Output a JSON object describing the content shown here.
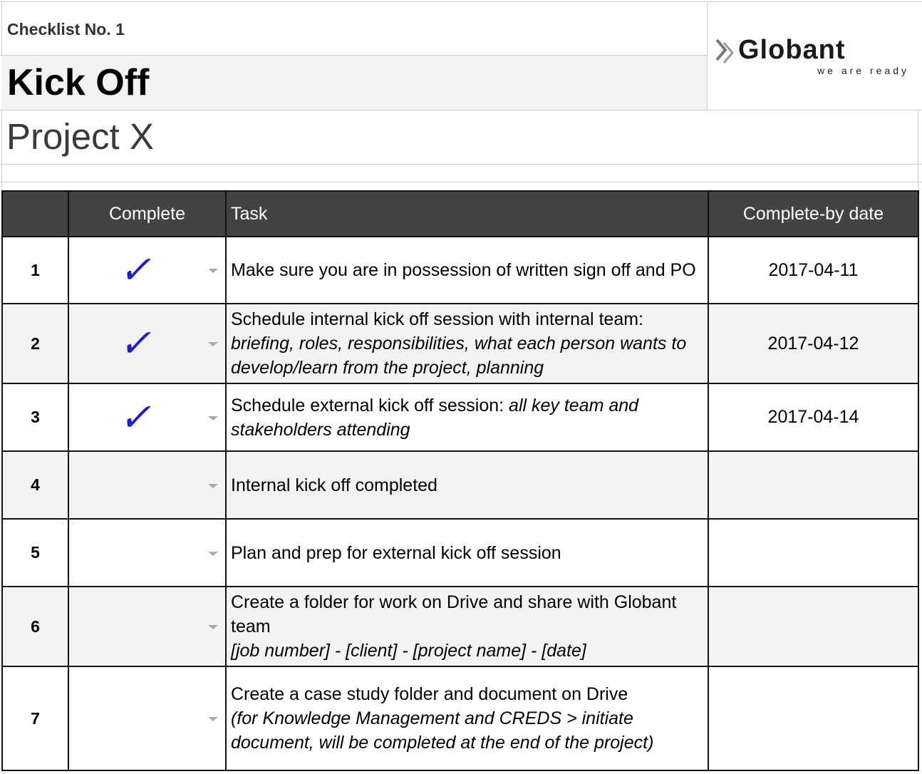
{
  "header": {
    "checklist_label": "Checklist No. 1",
    "title": "Kick Off",
    "project": "Project X"
  },
  "logo": {
    "name": "Globant",
    "tagline": "we are ready",
    "icon": "chevron-arrows-icon"
  },
  "table": {
    "columns": [
      "",
      "Complete",
      "Task",
      "Complete-by date"
    ],
    "rows": [
      {
        "num": "1",
        "complete": true,
        "task": "Make sure you are in possession of written sign off and PO",
        "task_italic": "",
        "date": "2017-04-11"
      },
      {
        "num": "2",
        "complete": true,
        "task": "Schedule internal kick off session with internal team:",
        "task_italic": "briefing, roles, responsibilities, what each person wants to develop/learn from the project, planning",
        "date": "2017-04-12"
      },
      {
        "num": "3",
        "complete": true,
        "task": "Schedule external kick off session:",
        "task_italic": "all key team and stakeholders attending",
        "date": "2017-04-14"
      },
      {
        "num": "4",
        "complete": false,
        "task": "Internal kick off completed",
        "task_italic": "",
        "date": ""
      },
      {
        "num": "5",
        "complete": false,
        "task": "Plan and prep for external kick off session",
        "task_italic": "",
        "date": ""
      },
      {
        "num": "6",
        "complete": false,
        "task": "Create a folder for work on Drive and share with Globant team",
        "task_italic": "[job number] - [client] - [project name] - [date]",
        "date": ""
      },
      {
        "num": "7",
        "complete": false,
        "task": "Create a case study folder and document on Drive",
        "task_italic": "(for Knowledge Management and CREDS > initiate document, will be completed at the end of the project)",
        "date": ""
      }
    ],
    "check_glyph": "✓",
    "check_color": "#1d1dd6",
    "header_bg": "#434343"
  }
}
